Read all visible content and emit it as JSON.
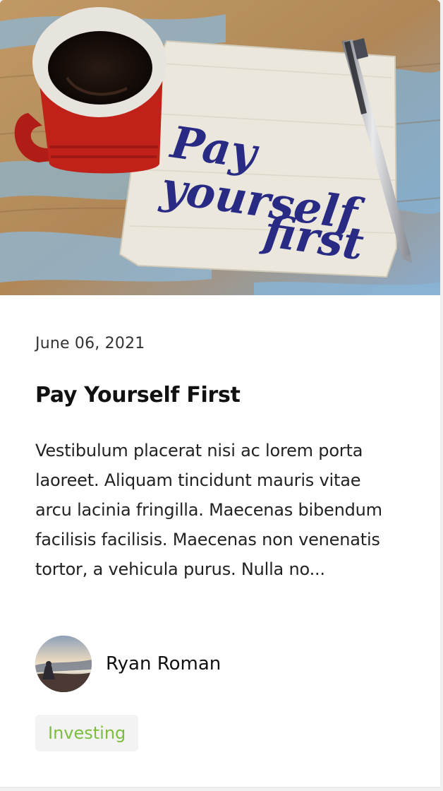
{
  "post": {
    "hero_image": "coffee-and-napkin-photo",
    "hero_text": [
      "Pay",
      "yourself",
      "first"
    ],
    "date": "June 06, 2021",
    "title": "Pay Yourself First",
    "excerpt": "Vestibulum placerat nisi ac lorem porta laoreet. Aliquam tincidunt mauris vitae arcu lacinia fringilla. Maecenas bibendum facilisis facilisis. Maecenas non venenatis tortor, a vehicula purus. Nulla no...",
    "author": {
      "name": "Ryan Roman",
      "avatar": "avatar-photo"
    },
    "tag": "Investing"
  },
  "colors": {
    "tag_text": "#7bbd3e",
    "tag_bg": "#f3f3f3",
    "mug": "#c8241c",
    "ink": "#2a2c8a"
  }
}
